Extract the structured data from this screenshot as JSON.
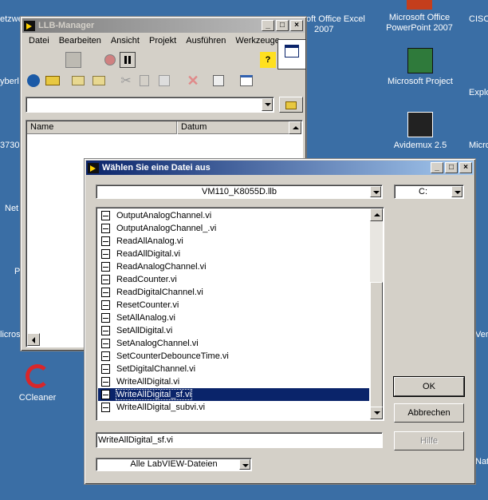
{
  "desktop": {
    "icons": [
      {
        "label": "Microsoft Office PowerPoint 2007"
      },
      {
        "label": "Microsoft Project"
      },
      {
        "label": "Avidemux 2.5"
      },
      {
        "label": "CCleaner"
      }
    ],
    "partial_labels": [
      "etzwe",
      "yberl",
      "3730",
      "Net",
      "P",
      "licros",
      "oft Office Excel",
      "2007",
      "CISC",
      "Explo",
      "Micro",
      "Verk",
      "Nat"
    ]
  },
  "llb_manager": {
    "title": "LLB-Manager",
    "menu": [
      "Datei",
      "Bearbeiten",
      "Ansicht",
      "Projekt",
      "Ausführen",
      "Werkzeuge"
    ],
    "columns": [
      "Name",
      "Datum"
    ],
    "path_value": ""
  },
  "dialog": {
    "title": "Wählen Sie eine Datei aus",
    "library": "VM110_K8055D.llb",
    "drive": "C:",
    "files": [
      "OutputAnalogChannel.vi",
      "OutputAnalogChannel_.vi",
      "ReadAllAnalog.vi",
      "ReadAllDigital.vi",
      "ReadAnalogChannel.vi",
      "ReadCounter.vi",
      "ReadDigitalChannel.vi",
      "ResetCounter.vi",
      "SetAllAnalog.vi",
      "SetAllDigital.vi",
      "SetAnalogChannel.vi",
      "SetCounterDebounceTime.vi",
      "SetDigitalChannel.vi",
      "WriteAllDigital.vi",
      "WriteAllDigital_sf.vi",
      "WriteAllDigital_subvi.vi"
    ],
    "selected_index": 14,
    "filename": "WriteAllDigital_sf.vi",
    "filetype": "Alle LabVIEW-Dateien",
    "ok_label": "OK",
    "cancel_label": "Abbrechen",
    "help_label": "Hilfe"
  },
  "window_buttons": {
    "minimize": "_",
    "maximize": "□",
    "close": "×"
  }
}
